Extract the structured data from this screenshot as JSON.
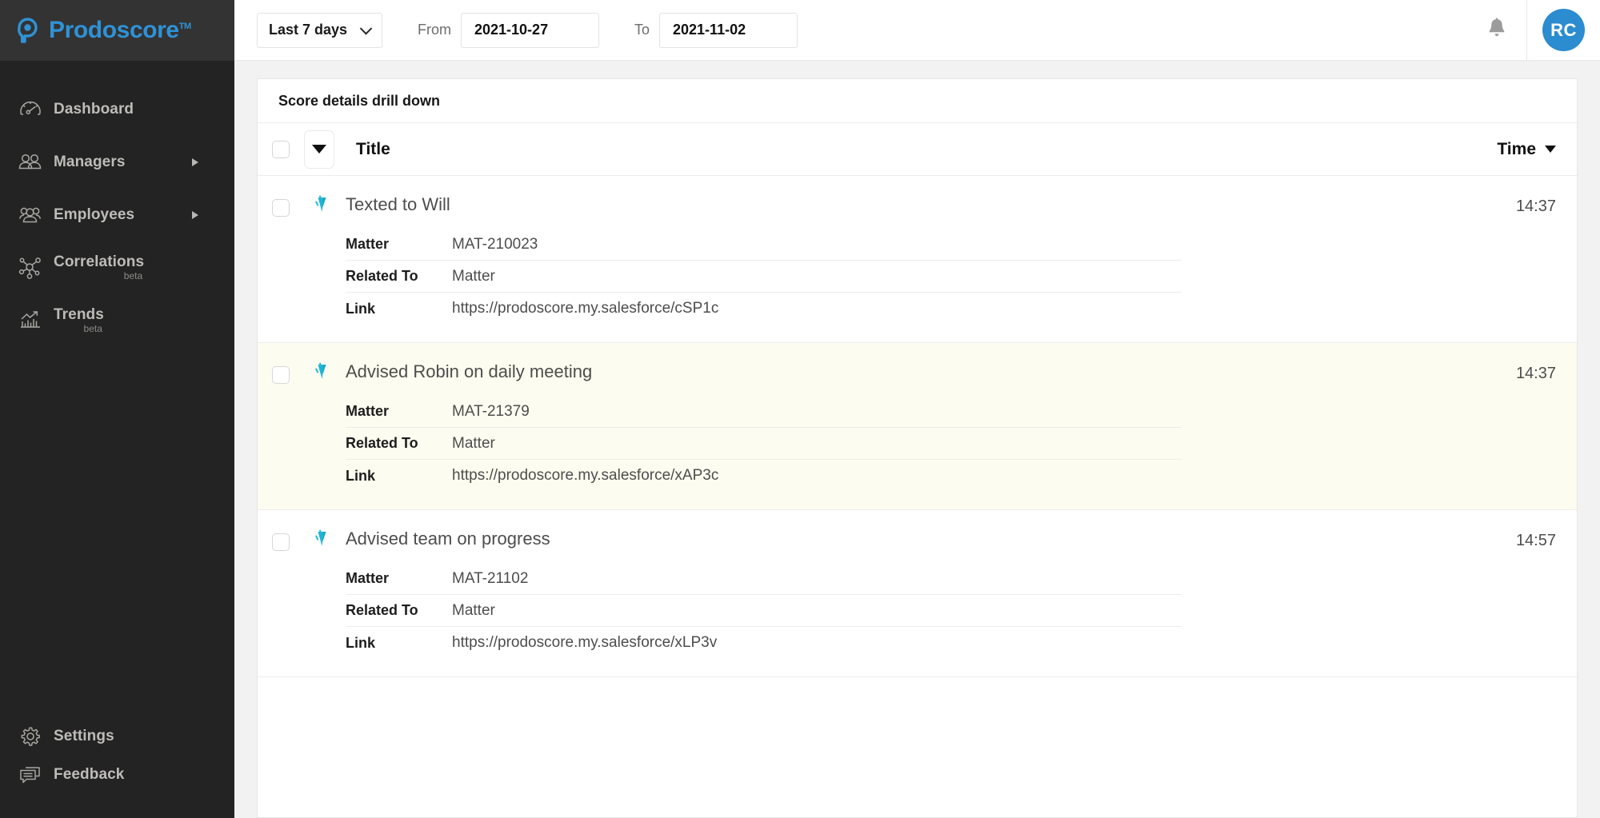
{
  "brand": {
    "name": "Prodoscore",
    "trademark": "TM",
    "accent_color": "#2f92d6",
    "logo_icon": "prodoscore-logo-icon"
  },
  "sidebar": {
    "items": [
      {
        "label": "Dashboard",
        "icon": "gauge-icon",
        "beta": "",
        "has_submenu": false
      },
      {
        "label": "Managers",
        "icon": "managers-icon",
        "beta": "",
        "has_submenu": true
      },
      {
        "label": "Employees",
        "icon": "employees-icon",
        "beta": "",
        "has_submenu": true
      },
      {
        "label": "Correlations",
        "icon": "correlations-icon",
        "beta": "beta",
        "has_submenu": false
      },
      {
        "label": "Trends",
        "icon": "trends-icon",
        "beta": "beta",
        "has_submenu": false
      }
    ],
    "bottom_items": [
      {
        "label": "Settings",
        "icon": "gear-icon"
      },
      {
        "label": "Feedback",
        "icon": "chat-bubble-icon"
      }
    ]
  },
  "topbar": {
    "range_select": {
      "value": "Last 7 days",
      "icon": "chevron-down-icon"
    },
    "from_label": "From",
    "from_value": "2021-10-27",
    "to_label": "To",
    "to_value": "2021-11-02",
    "notifications_icon": "bell-icon",
    "avatar_initials": "RC",
    "avatar_color": "#2b8cd0"
  },
  "card": {
    "title": "Score details drill down",
    "table": {
      "header": {
        "select_all_checkbox": "",
        "sort_icon": "triangle-down-icon",
        "title_column": "Title",
        "time_column": "Time",
        "time_sort_icon": "triangle-down-icon"
      },
      "field_labels": {
        "matter": "Matter",
        "related_to": "Related To",
        "link": "Link"
      },
      "rows": [
        {
          "title": "Texted to Will",
          "icon": "salesforce-activity-icon",
          "matter": "MAT-210023",
          "related_to": "Matter",
          "link": "https://prodoscore.my.salesforce/cSP1c",
          "time": "14:37",
          "highlighted": false
        },
        {
          "title": "Advised Robin on daily meeting",
          "icon": "salesforce-activity-icon",
          "matter": "MAT-21379",
          "related_to": "Matter",
          "link": "https://prodoscore.my.salesforce/xAP3c",
          "time": "14:37",
          "highlighted": true
        },
        {
          "title": "Advised team on progress",
          "icon": "salesforce-activity-icon",
          "matter": "MAT-21102",
          "related_to": "Matter",
          "link": "https://prodoscore.my.salesforce/xLP3v",
          "time": "14:57",
          "highlighted": false
        }
      ]
    }
  }
}
